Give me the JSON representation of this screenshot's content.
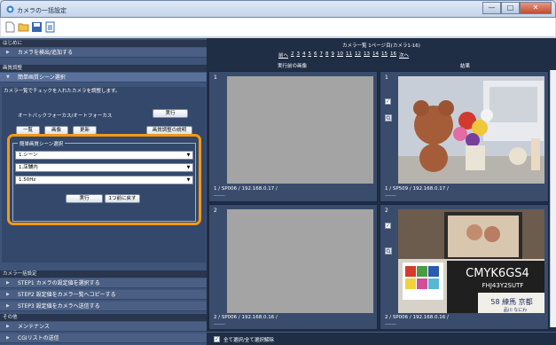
{
  "window": {
    "title": "カメラの一括設定",
    "min_glyph": "—",
    "max_glyph": "□",
    "close_glyph": "✕"
  },
  "left": {
    "sec_hajimeni": "はじめに",
    "item_detect": "カメラを検出/追加する",
    "sec_image_adjust": "画質調整",
    "item_simple_scene": "簡単画質シーン選択",
    "info_text": "カメラ一覧でチェックを入れたカメラを調整します。",
    "autofocus_label": "オートバックフォーカス/オートフォーカス",
    "exec_button": "実行",
    "list_button": "一覧",
    "image_button": "画像",
    "update_button": "更新",
    "adjust_help_button": "画質調整の説明",
    "group_label": "簡単画質シーン選択",
    "select_scene": "1.シーン",
    "select_place": "1.店舗内",
    "select_freq": "1.50Hz",
    "exec2_button": "実行",
    "back_button": "1つ前に戻す",
    "sec_bulk": "カメラ一括設定",
    "step1": "STEP1 カメラの設定値を選択する",
    "step2": "STEP2 設定値をカメラ一覧へコピーする",
    "step3": "STEP3 設定値をカメラへ送信する",
    "sec_other": "その他",
    "maintenance": "メンテナンス",
    "cg_send": "CGIリストの送信"
  },
  "right": {
    "list_title": "カメラ一覧 1ページ目(カメラ1-16)",
    "prev_link": "前へ",
    "pages": [
      "2",
      "3",
      "4",
      "5",
      "6",
      "7",
      "8",
      "9",
      "10",
      "11",
      "12",
      "13",
      "14",
      "15",
      "16"
    ],
    "next_link": "次へ",
    "before_header": "実行前の画像",
    "result_header": "結果",
    "cards": [
      {
        "num": "1",
        "info": "1 / SP006 / 192.168.0.17 /",
        "dash": "-------"
      },
      {
        "num": "1",
        "info": "1 / SP509 / 192.168.0.17 /",
        "dash": "-------"
      },
      {
        "num": "2",
        "info": "2 / SP006 / 192.168.0.16 /",
        "dash": "-------"
      },
      {
        "num": "2",
        "info": "2 / SP006 / 192.168.0.16 /",
        "dash": "-------"
      }
    ],
    "photo_text_1": "CMYK6GS4",
    "photo_text_2": "FHJ43Y2SUTF",
    "photo_text_3": "58 練馬 京都",
    "photo_text_4": "品川 なにわ",
    "select_all": "全て選択/全て選択解除"
  },
  "colors": {
    "left_bg": "#3e5479",
    "right_bg": "#1f2d45",
    "highlight": "#f49a14"
  }
}
